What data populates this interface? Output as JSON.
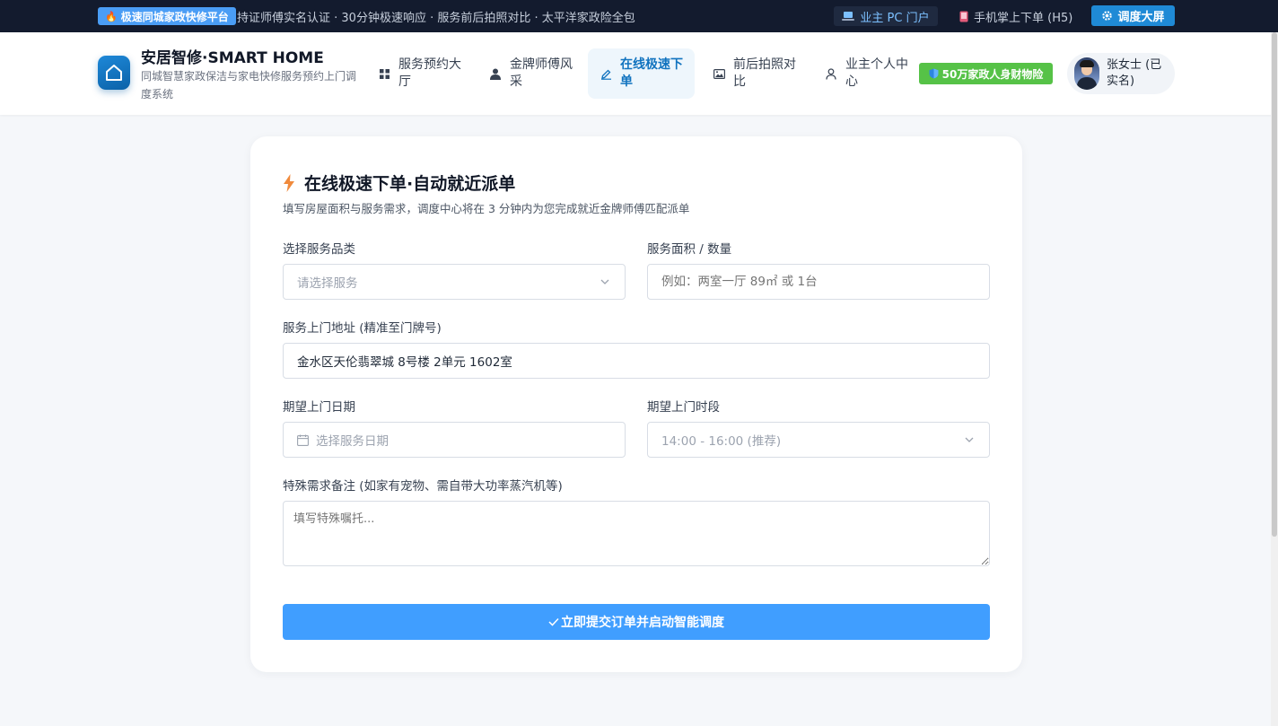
{
  "topbar": {
    "badge": "极速同城家政快修平台",
    "ticker": "持证师傅实名认证 · 30分钟极速响应 · 服务前后拍照对比 · 太平洋家政险全包",
    "pc_portal": "业主 PC 门户",
    "mobile": "手机掌上下单 (H5)",
    "dispatch_screen": "调度大屏"
  },
  "brand": {
    "title": "安居智修·SMART HOME",
    "subtitle": "同城智慧家政保洁与家电快修服务预约上门调度系统"
  },
  "nav": {
    "items": [
      {
        "label": "服务预约大厅",
        "icon": "grid-icon"
      },
      {
        "label": "金牌师傅风采",
        "icon": "person-icon"
      },
      {
        "label": "在线极速下单",
        "icon": "edit-icon",
        "active": true
      },
      {
        "label": "前后拍照对比",
        "icon": "image-icon"
      },
      {
        "label": "业主个人中心",
        "icon": "user-icon"
      }
    ]
  },
  "insurance_badge": "50万家政人身财物险",
  "user": {
    "name": "张女士 (已实名)"
  },
  "order_form": {
    "title": "在线极速下单·自动就近派单",
    "description": "填写房屋面积与服务需求，调度中心将在 3 分钟内为您完成就近金牌师傅匹配派单",
    "service_type": {
      "label": "选择服务品类",
      "placeholder": "请选择服务"
    },
    "area": {
      "label": "服务面积 / 数量",
      "placeholder": "例如：两室一厅 89㎡ 或 1台"
    },
    "address": {
      "label": "服务上门地址 (精准至门牌号)",
      "value": "金水区天伦翡翠城 8号楼 2单元 1602室"
    },
    "date": {
      "label": "期望上门日期",
      "placeholder": "选择服务日期"
    },
    "time_slot": {
      "label": "期望上门时段",
      "value": "14:00 - 16:00 (推荐)"
    },
    "notes": {
      "label": "特殊需求备注 (如家有宠物、需自带大功率蒸汽机等)",
      "placeholder": "填写特殊嘱托..."
    },
    "submit_label": "立即提交订单并启动智能调度"
  },
  "colors": {
    "topbar_bg": "#131b2e",
    "accent": "#409eff",
    "brand_blue": "#1173bf",
    "insurance_green": "#56c247"
  }
}
